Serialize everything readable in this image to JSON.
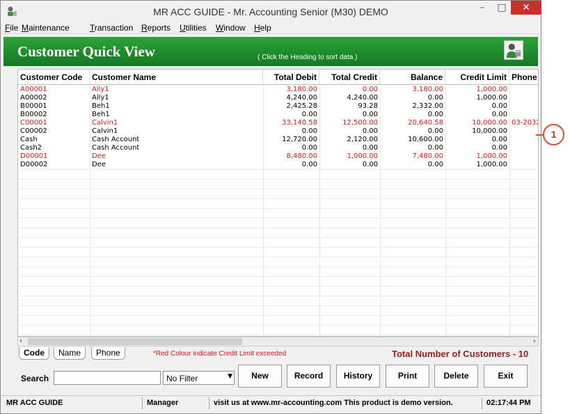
{
  "window": {
    "title": "MR ACC GUIDE - Mr. Accounting Senior (M30) DEMO",
    "close_glyph": "✕",
    "min_glyph": "–",
    "max_glyph": "□"
  },
  "menu": [
    "File",
    "Maintenance",
    "Transaction",
    "Reports",
    "Utilities",
    "Window",
    "Help"
  ],
  "banner": {
    "title": "Customer Quick View",
    "hint": "( Click the Heading to sort data )"
  },
  "table": {
    "columns": [
      "Customer Code",
      "Customer Name",
      "Total Debit",
      "Total Credit",
      "Balance",
      "Credit Limit",
      "Phone"
    ],
    "rows": [
      {
        "code": "A00001",
        "name": "Ally1",
        "debit": "3,180.00",
        "credit": "0.00",
        "balance": "3,180.00",
        "limit": "1,000.00",
        "phone": "",
        "exceeded": true
      },
      {
        "code": "A00002",
        "name": "Ally1",
        "debit": "4,240.00",
        "credit": "4,240.00",
        "balance": "0.00",
        "limit": "1,000.00",
        "phone": "",
        "exceeded": false
      },
      {
        "code": "B00001",
        "name": "Beh1",
        "debit": "2,425.28",
        "credit": "93.28",
        "balance": "2,332.00",
        "limit": "0.00",
        "phone": "",
        "exceeded": false
      },
      {
        "code": "B00002",
        "name": "Beh1",
        "debit": "0.00",
        "credit": "0.00",
        "balance": "0.00",
        "limit": "0.00",
        "phone": "",
        "exceeded": false
      },
      {
        "code": "C00001",
        "name": "Calvin1",
        "debit": "33,140.58",
        "credit": "12,500.00",
        "balance": "20,640.58",
        "limit": "10,000.00",
        "phone": "03-2032",
        "exceeded": true
      },
      {
        "code": "C00002",
        "name": "Calvin1",
        "debit": "0.00",
        "credit": "0.00",
        "balance": "0.00",
        "limit": "10,000.00",
        "phone": "",
        "exceeded": false
      },
      {
        "code": "Cash",
        "name": "Cash Account",
        "debit": "12,720.00",
        "credit": "2,120.00",
        "balance": "10,600.00",
        "limit": "0.00",
        "phone": "",
        "exceeded": false
      },
      {
        "code": "Cash2",
        "name": "Cash Account",
        "debit": "0.00",
        "credit": "0.00",
        "balance": "0.00",
        "limit": "0.00",
        "phone": "",
        "exceeded": false
      },
      {
        "code": "D00001",
        "name": "Dee",
        "debit": "8,480.00",
        "credit": "1,000.00",
        "balance": "7,480.00",
        "limit": "1,000.00",
        "phone": "",
        "exceeded": true
      },
      {
        "code": "D00002",
        "name": "Dee",
        "debit": "0.00",
        "credit": "0.00",
        "balance": "0.00",
        "limit": "1,000.00",
        "phone": "",
        "exceeded": false
      }
    ]
  },
  "tabs": [
    "Code",
    "Name",
    "Phone"
  ],
  "red_note": "*Red Colour indicate Credit Limit exceeded",
  "total_label": "Total Number of Customers - 10",
  "search": {
    "label": "Search",
    "value": "",
    "filter": "No Filter"
  },
  "buttons": [
    "New",
    "Record",
    "History",
    "Print",
    "Delete",
    "Exit"
  ],
  "status": {
    "company": "MR ACC GUIDE",
    "user": "Manager",
    "message": "visit us at www.mr-accounting.com This product is demo version.",
    "time": "02:17:44 PM"
  },
  "callout": "1",
  "colors": {
    "banner_green": "#1e8b2b",
    "exceeded_red": "#d2171c",
    "close_red": "#c9302c",
    "callout_orange": "#d74f2b"
  },
  "icons": {
    "app": "app-logo-icon",
    "banner": "customer-person-icon",
    "dropdown": "chevron-down-icon"
  }
}
